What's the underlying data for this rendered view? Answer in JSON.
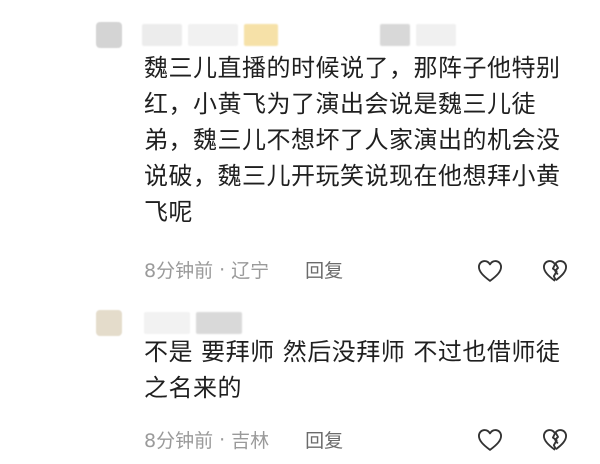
{
  "comments": [
    {
      "text": "魏三儿直播的时候说了，那阵子他特别\n红，小黄飞为了演出会说是魏三儿徒\n弟，魏三儿不想坏了人家演出的机会没\n说破，魏三儿开玩笑说现在他想拜小黄\n飞呢",
      "time": "8分钟前",
      "location": "辽宁",
      "reply_label": "回复",
      "like_icon": "heart-outline-icon",
      "dislike_icon": "broken-heart-icon"
    },
    {
      "text": "不是 要拜师 然后没拜师 不过也借师徒\n之名来的",
      "time": "8分钟前",
      "location": "吉林",
      "reply_label": "回复",
      "like_icon": "heart-outline-icon",
      "dislike_icon": "broken-heart-icon"
    }
  ],
  "separator": "·"
}
